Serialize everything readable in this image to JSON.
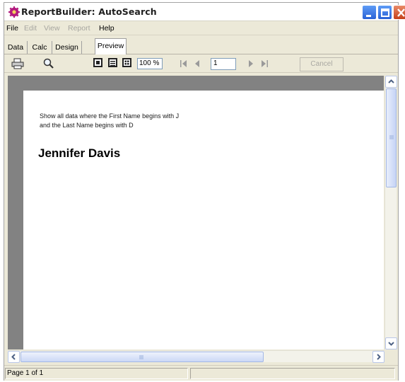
{
  "window": {
    "title": "ReportBuilder: AutoSearch"
  },
  "menu": {
    "items": [
      {
        "label": "File",
        "enabled": true
      },
      {
        "label": "Edit",
        "enabled": false
      },
      {
        "label": "View",
        "enabled": false
      },
      {
        "label": "Report",
        "enabled": false
      },
      {
        "label": "Help",
        "enabled": true
      }
    ]
  },
  "tabs": [
    {
      "label": "Data"
    },
    {
      "label": "Calc"
    },
    {
      "label": "Design"
    },
    {
      "label": "Preview",
      "active": true
    }
  ],
  "toolbar": {
    "zoom_value": "100 %",
    "page_value": "1",
    "cancel_label": "Cancel",
    "icons": [
      "printer-icon",
      "magnifier-icon",
      "whole-page-icon",
      "page-width-icon",
      "100-percent-icon",
      "first-page-icon",
      "prior-page-icon",
      "next-page-icon",
      "last-page-icon"
    ]
  },
  "report": {
    "description_line1": "Show all data where the First Name begins with J",
    "description_line2": "and the Last Name begins with D",
    "result_name": "Jennifer Davis"
  },
  "status": {
    "page_info": "Page 1 of 1"
  },
  "colors": {
    "report_background": "#828282",
    "title_close": "#c4401a",
    "title_buttons": "#2a62d6"
  }
}
